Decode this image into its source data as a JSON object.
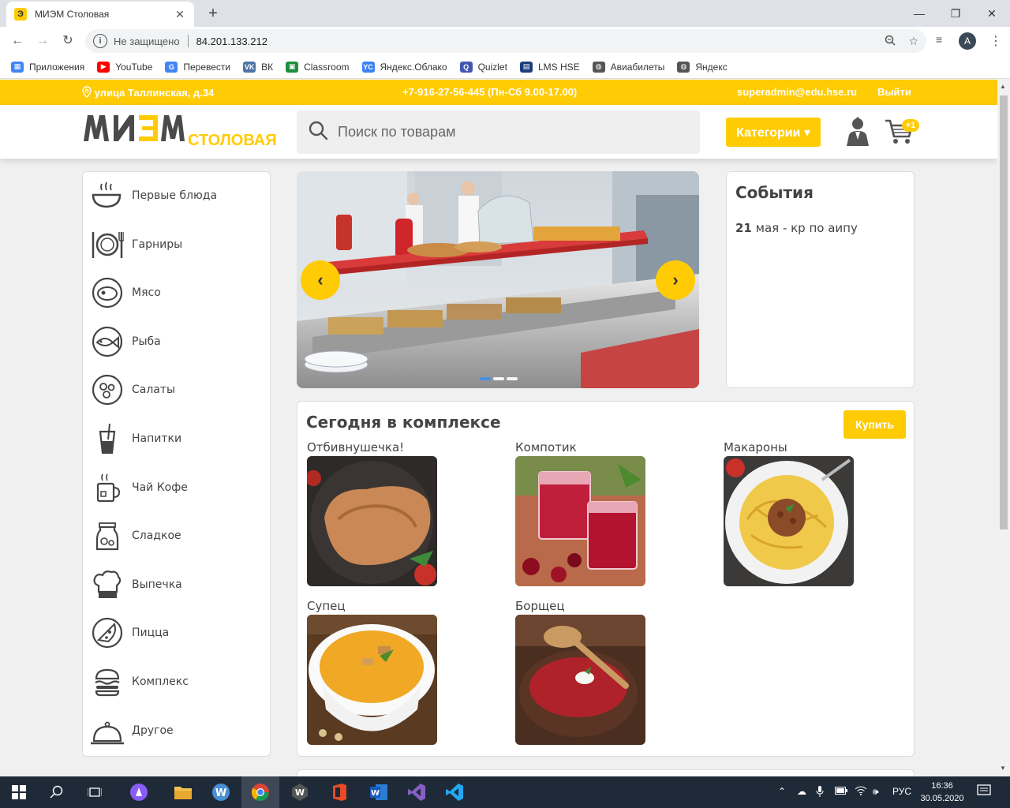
{
  "browser": {
    "tab_title": "МИЭМ Столовая",
    "tab_favicon_letter": "Э",
    "new_tab": "+",
    "security": "Не защищено",
    "url": "84.201.133.212",
    "profile_letter": "A"
  },
  "bookmarks": [
    {
      "label": "Приложения",
      "icon": "apps-grid-icon",
      "color": "#4285f4"
    },
    {
      "label": "YouTube",
      "icon": "youtube-icon",
      "color": "#ff0000"
    },
    {
      "label": "Перевести",
      "icon": "translate-icon",
      "color": "#4285f4"
    },
    {
      "label": "ВК",
      "icon": "vk-icon",
      "color": "#4c75a3"
    },
    {
      "label": "Classroom",
      "icon": "classroom-icon",
      "color": "#1e8e3e"
    },
    {
      "label": "Яндекс.Облако",
      "icon": "yandex-cloud-icon",
      "color": "#3b82f6"
    },
    {
      "label": "Quizlet",
      "icon": "quizlet-icon",
      "color": "#4257b2"
    },
    {
      "label": "LMS HSE",
      "icon": "lms-icon",
      "color": "#1a3d7c"
    },
    {
      "label": "Авиабилеты",
      "icon": "globe-icon",
      "color": "#555555"
    },
    {
      "label": "Яндекс",
      "icon": "globe-icon",
      "color": "#555555"
    }
  ],
  "topline": {
    "address": "улица Таллинская, д.34",
    "phone": "+7-916-27-56-445 (Пн-Сб 9.00-17.00)",
    "email": "superadmin@edu.hse.ru",
    "logout": "Выйти"
  },
  "header": {
    "logo_main": "МИЭМ",
    "logo_sub": "СТОЛОВАЯ",
    "search_placeholder": "Поиск по товарам",
    "categories_button": "Категории ▾",
    "cart_badge": "+1"
  },
  "sidebar": {
    "items": [
      {
        "label": "Первые блюда",
        "icon": "soup-bowl-icon"
      },
      {
        "label": "Гарниры",
        "icon": "plate-cutlery-icon"
      },
      {
        "label": "Мясо",
        "icon": "meat-icon"
      },
      {
        "label": "Рыба",
        "icon": "fish-icon"
      },
      {
        "label": "Салаты",
        "icon": "salad-icon"
      },
      {
        "label": "Напитки",
        "icon": "drink-icon"
      },
      {
        "label": "Чай Кофе",
        "icon": "coffee-cup-icon"
      },
      {
        "label": "Сладкое",
        "icon": "jar-sweets-icon"
      },
      {
        "label": "Выпечка",
        "icon": "chef-hat-icon"
      },
      {
        "label": "Пицца",
        "icon": "pizza-icon"
      },
      {
        "label": "Комплекс",
        "icon": "burger-icon"
      },
      {
        "label": "Другое",
        "icon": "cloche-icon"
      }
    ]
  },
  "slider": {
    "prev": "‹",
    "next": "›",
    "dots": 3,
    "active_dot": 0
  },
  "events": {
    "title": "События",
    "date": "21",
    "text": " мая - кр по аипу"
  },
  "complex": {
    "title": "Сегодня в комплексе",
    "buy_button": "Купить",
    "dishes": [
      {
        "name": "Отбивнушечка!",
        "image": "schnitzel-photo"
      },
      {
        "name": "Компотик",
        "image": "compote-photo"
      },
      {
        "name": "Макароны",
        "image": "pasta-photo"
      },
      {
        "name": "Супец",
        "image": "soup-photo"
      },
      {
        "name": "Борщец",
        "image": "borscht-photo"
      }
    ]
  },
  "taskbar": {
    "lang": "РУС",
    "time": "16:36",
    "date": "30.05.2020"
  },
  "colors": {
    "accent": "#ffcb05",
    "text": "#444444",
    "taskbar": "#1f2a38"
  }
}
